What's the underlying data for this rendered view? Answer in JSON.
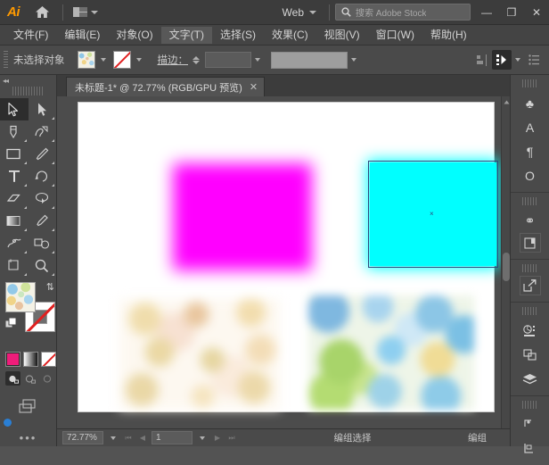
{
  "app": {
    "name": "Ai",
    "logo_label": "Ai"
  },
  "titlebar": {
    "home_icon": "home-icon",
    "layout_icon": "arrange-documents-icon",
    "layout_caret": "▾",
    "web_label": "Web",
    "web_caret": "▾",
    "search": {
      "icon": "search-icon",
      "placeholder": "搜索 Adobe Stock",
      "value": ""
    },
    "window_controls": {
      "minimize": "—",
      "maximize": "❐",
      "close": "✕"
    }
  },
  "menubar": {
    "items": [
      {
        "label": "文件(F)",
        "highlighted": false
      },
      {
        "label": "编辑(E)",
        "highlighted": false
      },
      {
        "label": "对象(O)",
        "highlighted": false
      },
      {
        "label": "文字(T)",
        "highlighted": true
      },
      {
        "label": "选择(S)",
        "highlighted": false
      },
      {
        "label": "效果(C)",
        "highlighted": false
      },
      {
        "label": "视图(V)",
        "highlighted": false
      },
      {
        "label": "窗口(W)",
        "highlighted": false
      },
      {
        "label": "帮助(H)",
        "highlighted": false
      }
    ]
  },
  "controlbar": {
    "selection_status": "未选择对象",
    "fill_swatch_name": "fill-pattern-swatch",
    "stroke_swatch_name": "stroke-none-swatch",
    "stroke_label": "描边：",
    "stroke_weight_value": "",
    "profile_value": "",
    "align_icon": "align-icon",
    "transform_icon": "transform-icon",
    "options_icon": "more-options-icon"
  },
  "toolbar": {
    "collapse_icon": "collapse-panel-icon",
    "tools": [
      {
        "name": "selection-tool",
        "glyph": "selection-arrow",
        "selected": true
      },
      {
        "name": "direct-selection-tool",
        "glyph": "direct-arrow",
        "selected": false
      },
      {
        "name": "pen-tool",
        "glyph": "pen",
        "selected": false
      },
      {
        "name": "curvature-tool",
        "glyph": "curvature",
        "selected": false
      },
      {
        "name": "rectangle-tool",
        "glyph": "rectangle",
        "selected": false
      },
      {
        "name": "paintbrush-tool",
        "glyph": "brush",
        "selected": false
      },
      {
        "name": "type-tool",
        "glyph": "type-T",
        "selected": false
      },
      {
        "name": "rotate-tool",
        "glyph": "rotate",
        "selected": false
      },
      {
        "name": "eraser-tool",
        "glyph": "eraser",
        "selected": false
      },
      {
        "name": "shape-builder-tool",
        "glyph": "shape-builder",
        "selected": false
      },
      {
        "name": "gradient-tool",
        "glyph": "gradient",
        "selected": false
      },
      {
        "name": "eyedropper-tool",
        "glyph": "eyedropper",
        "selected": false
      },
      {
        "name": "width-tool",
        "glyph": "puppet-warp",
        "selected": false
      },
      {
        "name": "blend-tool",
        "glyph": "blend",
        "selected": false
      },
      {
        "name": "artboard-tool",
        "glyph": "artboard",
        "selected": false
      },
      {
        "name": "zoom-tool",
        "glyph": "magnifier",
        "selected": false
      }
    ],
    "fill_name": "fill-pattern",
    "stroke_name": "stroke-none",
    "swap_icon": "swap-fill-stroke-icon",
    "default_icon": "default-fill-stroke-icon",
    "color_modes": [
      {
        "name": "color-button",
        "selected": false
      },
      {
        "name": "gradient-button",
        "selected": false
      },
      {
        "name": "none-button",
        "selected": false
      }
    ],
    "draw_modes": [
      {
        "name": "draw-normal-mode",
        "selected": true
      },
      {
        "name": "draw-behind-mode",
        "selected": false
      },
      {
        "name": "draw-inside-mode",
        "selected": false
      }
    ],
    "screen_mode_icon": "change-screen-mode-icon",
    "more_tools_icon": "edit-toolbar-icon",
    "more_tools_glyph": "•••"
  },
  "document": {
    "tab_title": "未标题-1* @ 72.77% (RGB/GPU 预览)",
    "tab_close": "✕",
    "artwork": [
      {
        "name": "magenta-rectangle",
        "color": "#ff00ff",
        "selected": false
      },
      {
        "name": "cyan-rectangle",
        "color": "#00ffff",
        "selected": true
      },
      {
        "name": "cream-floral-pattern",
        "color": "#fdf8f0",
        "selected": false
      },
      {
        "name": "colorful-pattern",
        "color": "#eef5e8",
        "selected": false
      }
    ],
    "selection_anchor": "×"
  },
  "statusbar": {
    "zoom_value": "72.77%",
    "zoom_caret": "▾",
    "nav_first": "⏮",
    "nav_prev": "◀",
    "page_value": "1",
    "page_caret": "▾",
    "nav_next": "▶",
    "nav_last": "⏭",
    "tool_status": "编组选择",
    "group_status": "编组"
  },
  "rightdock": {
    "groups": [
      {
        "icons": [
          {
            "name": "symbols-panel-icon",
            "glyph": "♣"
          },
          {
            "name": "character-panel-icon",
            "glyph": "A"
          },
          {
            "name": "paragraph-panel-icon",
            "glyph": "¶"
          },
          {
            "name": "opacity-panel-icon",
            "glyph": "O"
          }
        ]
      },
      {
        "icons": [
          {
            "name": "links-panel-icon",
            "glyph": "⚭"
          },
          {
            "name": "artboards-panel-icon",
            "glyph": "❐"
          }
        ]
      },
      {
        "icons": [
          {
            "name": "asset-export-panel-icon",
            "glyph": "↗"
          }
        ]
      },
      {
        "icons": [
          {
            "name": "properties-panel-icon",
            "glyph": "◑"
          },
          {
            "name": "pathfinder-panel-icon",
            "glyph": "❐"
          },
          {
            "name": "layers-panel-icon",
            "glyph": "◈"
          }
        ]
      },
      {
        "icons": [
          {
            "name": "transform-panel-icon",
            "glyph": "⌐"
          },
          {
            "name": "align-panel-icon",
            "glyph": "⌞"
          }
        ]
      }
    ]
  },
  "colors": {
    "chrome": "#4a4a4a",
    "titlebar": "#3c3c3c",
    "canvas": "#4c4c4c",
    "artboard": "#ffffff",
    "accent_orange": "#ff9a00",
    "selection_blue": "#2e4a7d",
    "magenta": "#ff00ff",
    "cyan": "#00ffff"
  }
}
